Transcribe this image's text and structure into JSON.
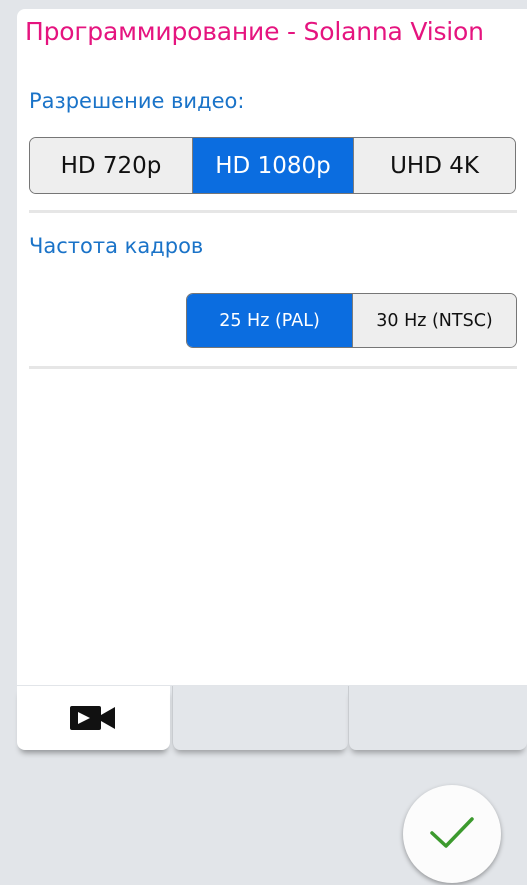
{
  "header": {
    "title": "Программирование - Solanna Vision"
  },
  "resolution": {
    "label": "Разрешение видео:",
    "options": [
      "HD 720p",
      "HD 1080p",
      "UHD 4K"
    ],
    "selected": "HD 1080p"
  },
  "frame_rate": {
    "label": "Частота кадров",
    "options": [
      "25 Hz (PAL)",
      "30 Hz (NTSC)"
    ],
    "selected": "25 Hz (PAL)"
  },
  "tabs": [
    {
      "icon": "video-camera-icon",
      "active": true
    },
    {
      "icon": "",
      "active": false
    },
    {
      "icon": "",
      "active": false
    }
  ],
  "confirm_button": {
    "icon": "checkmark-icon"
  },
  "colors": {
    "title": "#e5147f",
    "label": "#1a73c8",
    "selected_segment": "#0b6de0",
    "checkmark": "#3c9a2e"
  }
}
